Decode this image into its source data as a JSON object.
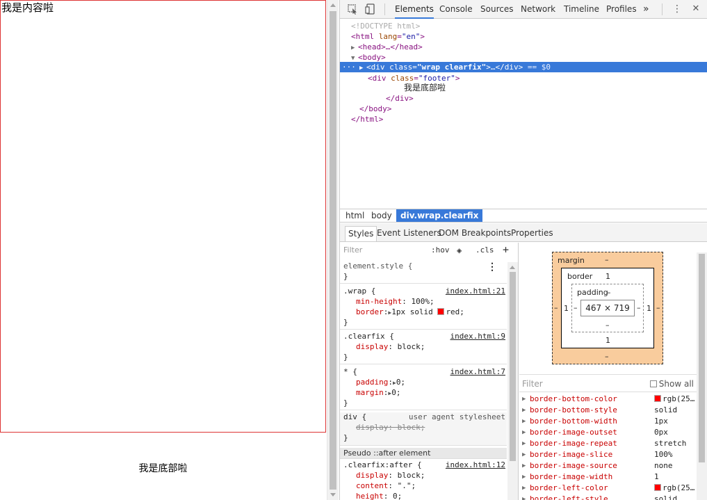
{
  "page": {
    "wrap_text": "我是内容啦",
    "footer_text": "我是底部啦"
  },
  "toolbar": {
    "tabs": [
      "Elements",
      "Console",
      "Sources",
      "Network",
      "Timeline",
      "Profiles"
    ],
    "more": "»",
    "menu": "⋮",
    "close": "✕"
  },
  "tree": {
    "doctype": "<!DOCTYPE html>",
    "html_open": "<html",
    "html_lang_attr": "lang",
    "html_lang_val": "\"en\"",
    "head": "<head>…</head>",
    "body_open": "<body>",
    "ellipsis": "···",
    "wrap_div_open": "<div",
    "wrap_class_attr": "class",
    "wrap_class_val": "\"wrap clearfix\"",
    "wrap_div_close": ">…</div>",
    "selected_marker": " == $0",
    "footer_div_open": "<div",
    "footer_class_attr": "class",
    "footer_class_val": "\"footer\"",
    "footer_text": "我是底部啦",
    "div_close": "</div>",
    "body_close": "</body>",
    "html_close": "</html>",
    "gt": ">"
  },
  "breadcrumb": [
    "html",
    "body",
    "div.wrap.clearfix"
  ],
  "subtabs": [
    "Styles",
    "Event Listeners",
    "DOM Breakpoints",
    "Properties"
  ],
  "styles": {
    "filter_placeholder": "Filter",
    "hov": ":hov",
    "cls": ".cls",
    "plus": "+",
    "element_style": "element.style {",
    "rules": [
      {
        "selector": ".wrap {",
        "source": "index.html:21"
      },
      {
        "selector": ".clearfix {",
        "source": "index.html:9"
      },
      {
        "selector": "* {",
        "source": "index.html:7"
      },
      {
        "selector": "div {",
        "source": "user agent stylesheet"
      },
      {
        "selector": ".clearfix:after {",
        "source": "index.html:12"
      }
    ],
    "close_brace": "}",
    "props": {
      "min_height_name": "min-height",
      "min_height_val": "100%;",
      "border_name": "border",
      "border_val_1": "1px solid",
      "border_val_2": "red;",
      "display_name": "display",
      "display_val": "block;",
      "padding_name": "padding",
      "padding_val": "0;",
      "margin_name": "margin",
      "margin_val": "0;",
      "ua_display": "display: block;",
      "after_display_name": "display",
      "after_display_val": "block;",
      "content_name": "content",
      "content_val": "\".\";",
      "height_name": "height",
      "height_val": "0;"
    },
    "pseudo_header": "Pseudo ::after element",
    "swatch_color": "#ff0000"
  },
  "box_model": {
    "margin_label": "margin",
    "margin_top": "–",
    "margin_bottom": "–",
    "margin_left": "–",
    "margin_right": "–",
    "border_label": "border",
    "border_top": "1",
    "border_bottom": "1",
    "border_left": "1",
    "border_right": "1",
    "padding_label": "padding",
    "padding_top": "–",
    "padding_bottom": "–",
    "padding_left": "–",
    "padding_right": "–",
    "content": "467 × 719"
  },
  "computed": {
    "filter_placeholder": "Filter",
    "show_all": "Show all",
    "props": [
      {
        "name": "border-bottom-color",
        "value": "rgb(25…",
        "swatch": true
      },
      {
        "name": "border-bottom-style",
        "value": "solid"
      },
      {
        "name": "border-bottom-width",
        "value": "1px"
      },
      {
        "name": "border-image-outset",
        "value": "0px"
      },
      {
        "name": "border-image-repeat",
        "value": "stretch"
      },
      {
        "name": "border-image-slice",
        "value": "100%"
      },
      {
        "name": "border-image-source",
        "value": "none"
      },
      {
        "name": "border-image-width",
        "value": "1"
      },
      {
        "name": "border-left-color",
        "value": "rgb(25…",
        "swatch": true
      },
      {
        "name": "border-left-style",
        "value": "solid"
      }
    ]
  }
}
